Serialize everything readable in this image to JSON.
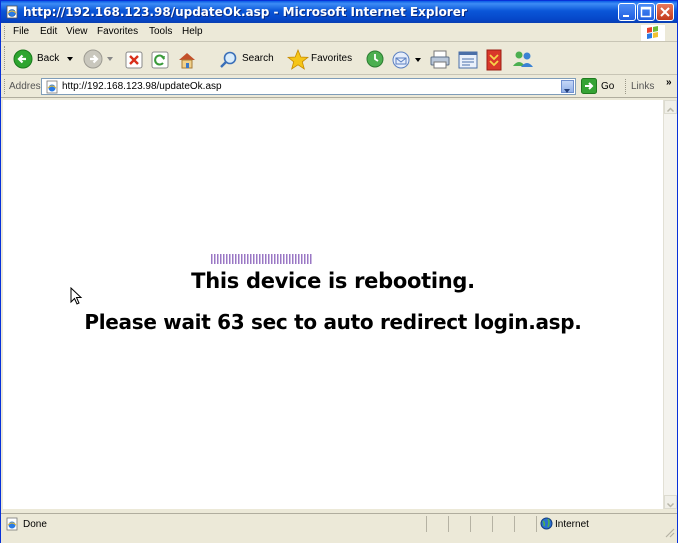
{
  "window": {
    "title": "http://192.168.123.98/updateOk.asp - Microsoft Internet Explorer"
  },
  "menu": {
    "items": [
      "File",
      "Edit",
      "View",
      "Favorites",
      "Tools",
      "Help"
    ]
  },
  "toolbar": {
    "back_label": "Back",
    "search_label": "Search",
    "favorites_label": "Favorites"
  },
  "addressbar": {
    "label": "Address",
    "url": "http://192.168.123.98/updateOk.asp",
    "go_label": "Go",
    "links_label": "Links"
  },
  "page": {
    "message_line1": "This device is rebooting.",
    "message_line2": "Please wait 63 sec to  auto redirect login.asp.",
    "progress_color": "#9a77c4"
  },
  "status": {
    "text": "Done",
    "zone": "Internet"
  },
  "colors": {
    "titlebar": "#0a56d8",
    "chrome": "#ece9d8"
  }
}
